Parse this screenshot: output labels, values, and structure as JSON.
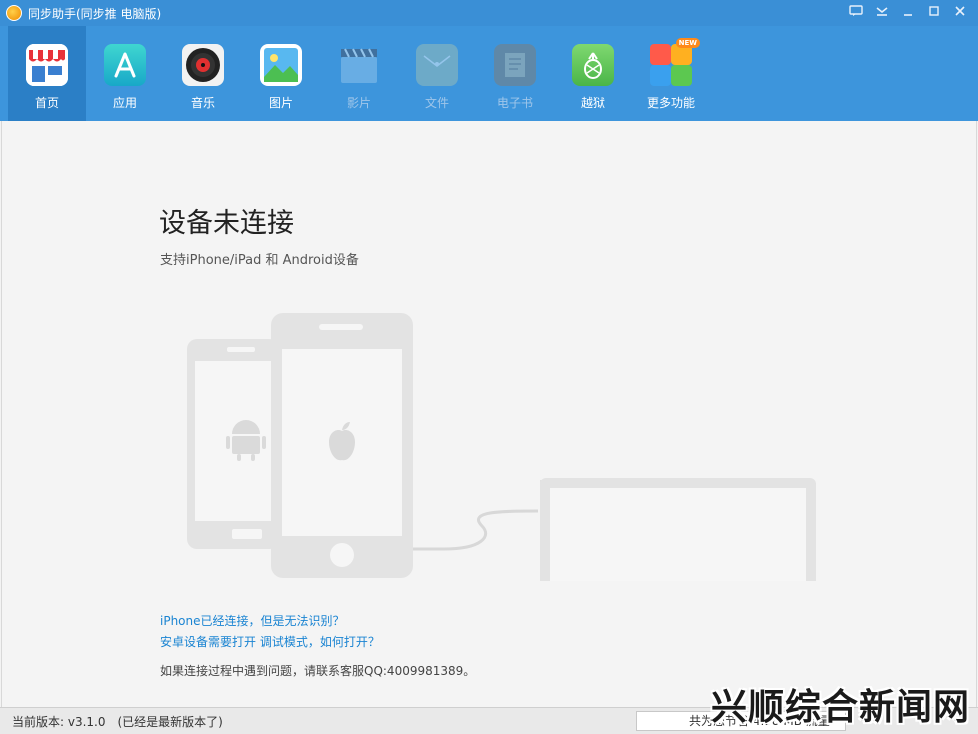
{
  "titlebar": {
    "title": "同步助手(同步推 电脑版)"
  },
  "window_controls": [
    "feedback-icon",
    "menu-icon",
    "minimize-icon",
    "maximize-icon",
    "close-icon"
  ],
  "toolbar": {
    "items": [
      {
        "label": "首页",
        "icon": "store-icon",
        "active": true,
        "enabled": true
      },
      {
        "label": "应用",
        "icon": "appstore-icon",
        "active": false,
        "enabled": true
      },
      {
        "label": "音乐",
        "icon": "music-disc-icon",
        "active": false,
        "enabled": true
      },
      {
        "label": "图片",
        "icon": "picture-icon",
        "active": false,
        "enabled": true
      },
      {
        "label": "影片",
        "icon": "clapboard-icon",
        "active": false,
        "enabled": false
      },
      {
        "label": "文件",
        "icon": "folder-icon",
        "active": false,
        "enabled": false
      },
      {
        "label": "电子书",
        "icon": "book-icon",
        "active": false,
        "enabled": false
      },
      {
        "label": "越狱",
        "icon": "pineapple-icon",
        "active": false,
        "enabled": true
      },
      {
        "label": "更多功能",
        "icon": "grid-icon",
        "active": false,
        "enabled": true,
        "badge": "NEW"
      }
    ]
  },
  "main": {
    "title": "设备未连接",
    "subtitle": "支持iPhone/iPad 和 Android设备",
    "help_link_1": "iPhone已经连接，但是无法识别？",
    "help_link_2": "安卓设备需要打开 调试模式，如何打开？",
    "contact": "如果连接过程中遇到问题，请联系客服QQ:4009981389。"
  },
  "watermark": "兴顺综合新闻网",
  "status": {
    "version": "当前版本: v3.1.0",
    "version_note": "(已经是最新版本了)",
    "traffic": "共为您节省 4.98 MB 流量"
  },
  "colors": {
    "titlebar": "#3a8fd6",
    "toolbar": "#3d95dc",
    "toolbar_active": "#2b7fc6",
    "link": "#1a84d2",
    "device_gray": "#e1e1e1"
  }
}
